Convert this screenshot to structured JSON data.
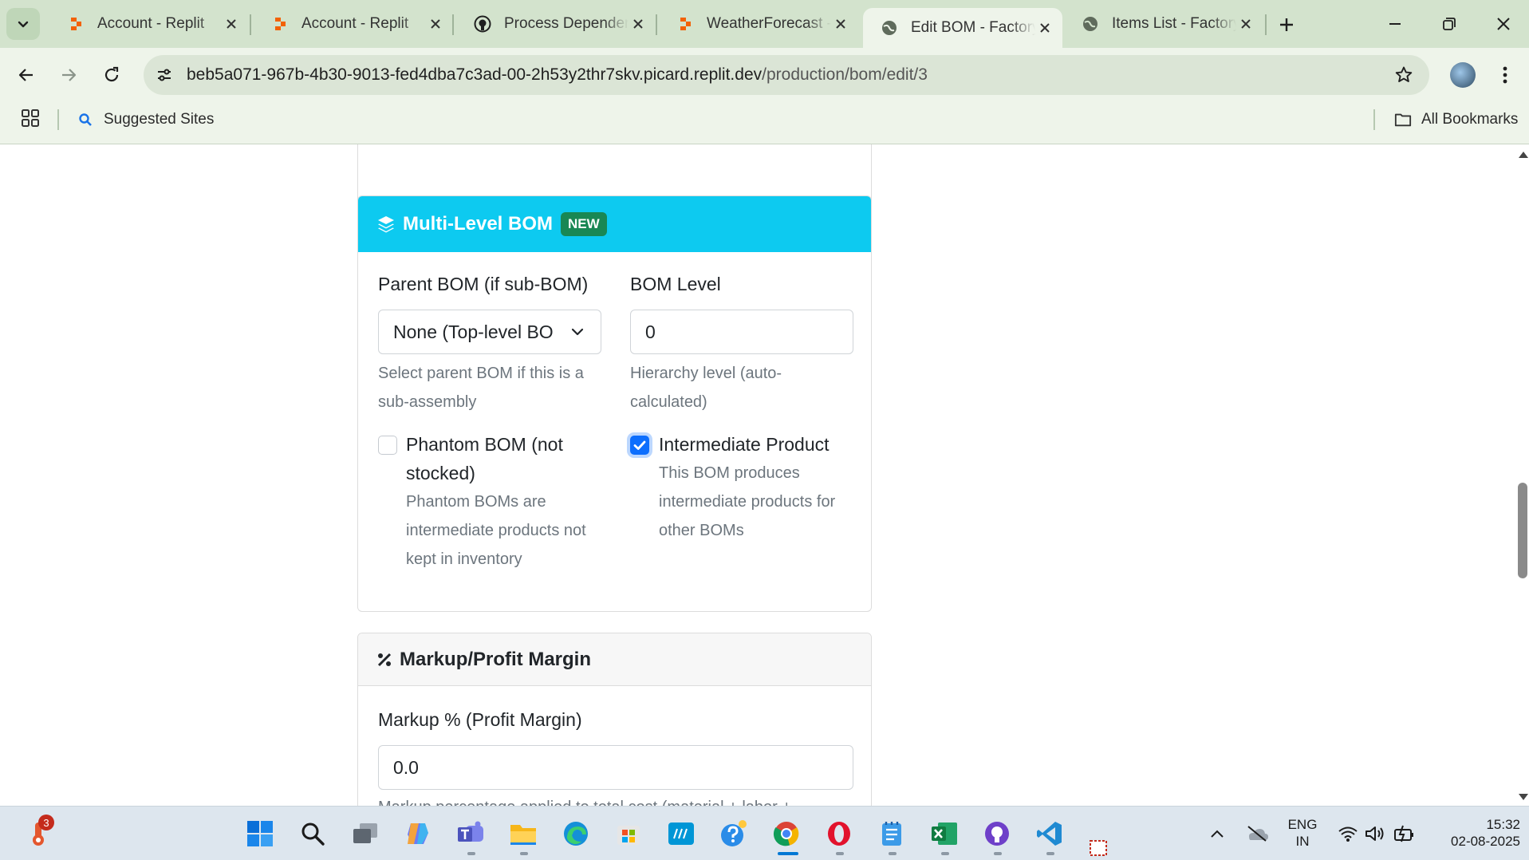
{
  "browser": {
    "tabs": [
      {
        "title": "Account - Replit",
        "icon": "replit-icon"
      },
      {
        "title": "Account - Replit",
        "icon": "replit-icon"
      },
      {
        "title": "Process Dependen",
        "icon": "github-icon"
      },
      {
        "title": "WeatherForecast -",
        "icon": "replit-icon"
      },
      {
        "title": "Edit BOM - Factory",
        "icon": "globe-icon",
        "active": true
      },
      {
        "title": "Items List - Factory",
        "icon": "globe-icon"
      }
    ],
    "url_host": "beb5a071-967b-4b30-9013-fed4dba7c3ad-00-2h53y2thr7skv.picard.replit.dev",
    "url_path": "/production/bom/edit/3",
    "bookmarks": {
      "suggested": "Suggested Sites",
      "all": "All Bookmarks"
    }
  },
  "page": {
    "multilevel": {
      "title": "Multi-Level BOM",
      "badge": "NEW",
      "parent_label": "Parent BOM (if sub-BOM)",
      "parent_value": "None (Top-level BO",
      "parent_help": "Select parent BOM if this is a sub-assembly",
      "level_label": "BOM Level",
      "level_value": "0",
      "level_help": "Hierarchy level (auto-calculated)",
      "phantom_label": "Phantom BOM (not stocked)",
      "phantom_checked": false,
      "phantom_help": "Phantom BOMs are intermediate products not kept in inventory",
      "intermediate_label": "Intermediate Product",
      "intermediate_checked": true,
      "intermediate_help": "This BOM produces intermediate products for other BOMs"
    },
    "markup": {
      "title": "Markup/Profit Margin",
      "field_label": "Markup % (Profit Margin)",
      "field_value": "0.0",
      "help": "Markup percentage applied to total cost (material + labor +"
    }
  },
  "taskbar": {
    "notification_count": "3",
    "lang_1": "ENG",
    "lang_2": "IN",
    "time": "15:32",
    "date": "02-08-2025"
  },
  "colors": {
    "header_info": "#0dcaf0",
    "badge_success": "#198754",
    "checkbox_primary": "#0d6efd",
    "chrome_frame": "#d3e3cd"
  }
}
